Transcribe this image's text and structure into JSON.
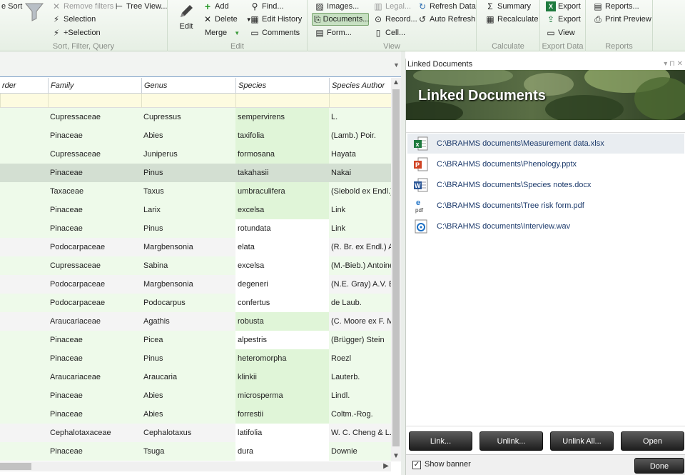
{
  "ribbon": {
    "groups": [
      {
        "label": "Sort, Filter, Query"
      },
      {
        "label": "Edit"
      },
      {
        "label": "View"
      },
      {
        "label": "Calculate"
      },
      {
        "label": "Export Data"
      },
      {
        "label": "Reports"
      }
    ],
    "sort": {
      "sort_label": "e Sort",
      "remove_filters": "Remove filters",
      "tree_view": "Tree View...",
      "selection": "Selection",
      "plus_selection": "+Selection"
    },
    "edit": {
      "edit_label": "Edit",
      "add": "Add",
      "delete": "Delete",
      "merge": "Merge",
      "find": "Find...",
      "edit_history": "Edit History",
      "comments": "Comments"
    },
    "view": {
      "images": "Images...",
      "documents": "Documents...",
      "form": "Form...",
      "legal": "Legal...",
      "record": "Record...",
      "cell": "Cell...",
      "refresh_data": "Refresh Data",
      "auto_refresh": "Auto Refresh"
    },
    "calculate": {
      "summary": "Summary",
      "recalculate": "Recalculate"
    },
    "export": {
      "export1": "Export",
      "export2": "Export",
      "view": "View"
    },
    "reports": {
      "reports": "Reports...",
      "print_preview": "Print Preview"
    }
  },
  "grid": {
    "columns": [
      "rder",
      "Family",
      "Genus",
      "Species",
      "Species Author"
    ],
    "rows": [
      [
        "",
        "Cupressaceae",
        "Cupressus",
        "sempervirens",
        "L."
      ],
      [
        "",
        "Pinaceae",
        "Abies",
        "taxifolia",
        "(Lamb.) Poir."
      ],
      [
        "",
        "Cupressaceae",
        "Juniperus",
        "formosana",
        "Hayata"
      ],
      [
        "",
        "Pinaceae",
        "Pinus",
        "takahasii",
        "Nakai"
      ],
      [
        "",
        "Taxaceae",
        "Taxus",
        "umbraculifera",
        "(Siebold ex Endl.)"
      ],
      [
        "",
        "Pinaceae",
        "Larix",
        "excelsa",
        "Link"
      ],
      [
        "",
        "Pinaceae",
        "Pinus",
        "rotundata",
        "Link"
      ],
      [
        "",
        "Podocarpaceae",
        "Margbensonia",
        "elata",
        "(R. Br. ex Endl.) A.V"
      ],
      [
        "",
        "Cupressaceae",
        "Sabina",
        "excelsa",
        "(M.-Bieb.) Antoine"
      ],
      [
        "",
        "Podocarpaceae",
        "Margbensonia",
        "degeneri",
        "(N.E. Gray) A.V. Bo"
      ],
      [
        "",
        "Podocarpaceae",
        "Podocarpus",
        "confertus",
        "de Laub."
      ],
      [
        "",
        "Araucariaceae",
        "Agathis",
        "robusta",
        "(C. Moore ex F. M"
      ],
      [
        "",
        "Pinaceae",
        "Picea",
        "alpestris",
        "(Brügger) Stein"
      ],
      [
        "",
        "Pinaceae",
        "Pinus",
        "heteromorpha",
        "Roezl"
      ],
      [
        "",
        "Araucariaceae",
        "Araucaria",
        "klinkii",
        "Lauterb."
      ],
      [
        "",
        "Pinaceae",
        "Abies",
        "microsperma",
        "Lindl."
      ],
      [
        "",
        "Pinaceae",
        "Abies",
        "forrestii",
        "Coltm.-Rog."
      ],
      [
        "",
        "Cephalotaxaceae",
        "Cephalotaxus",
        "latifolia",
        "W. C. Cheng & L.K"
      ],
      [
        "",
        "Pinaceae",
        "Tsuga",
        "dura",
        "Downie"
      ]
    ]
  },
  "panel": {
    "title": "Linked Documents",
    "banner_title": "Linked Documents",
    "documents": [
      {
        "path": "C:\\BRAHMS documents\\Measurement data.xlsx",
        "icon": "excel-icon"
      },
      {
        "path": "C:\\BRAHMS documents\\Phenology.pptx",
        "icon": "powerpoint-icon"
      },
      {
        "path": "C:\\BRAHMS documents\\Species notes.docx",
        "icon": "word-icon"
      },
      {
        "path": "C:\\BRAHMS documents\\Tree risk form.pdf",
        "icon": "pdf-icon"
      },
      {
        "path": "C:\\BRAHMS documents\\Interview.wav",
        "icon": "audio-icon"
      }
    ],
    "buttons": {
      "link": "Link...",
      "unlink": "Unlink...",
      "unlink_all": "Unlink All...",
      "open": "Open"
    },
    "show_banner": "Show banner",
    "done": "Done"
  },
  "colors": {
    "accent": "#7aa570",
    "row_green": "#eefaea",
    "row_alt": "#f4f4f4",
    "selected_row": "#d3dfd2"
  }
}
